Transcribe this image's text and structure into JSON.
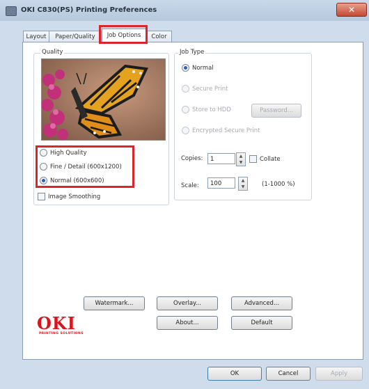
{
  "window": {
    "title": "OKI C830(PS) Printing Preferences",
    "close_glyph": "✕"
  },
  "tabs": [
    {
      "label": "Layout"
    },
    {
      "label": "Paper/Quality"
    },
    {
      "label": "Job Options",
      "active": true
    },
    {
      "label": "Color"
    }
  ],
  "quality": {
    "group_label": "Quality",
    "options": [
      {
        "label": "High Quality",
        "selected": false
      },
      {
        "label": "Fine / Detail (600x1200)",
        "selected": false
      },
      {
        "label": "Normal (600x600)",
        "selected": true
      }
    ],
    "image_smoothing_label": "Image Smoothing",
    "image_smoothing_checked": false
  },
  "job_type": {
    "group_label": "Job Type",
    "options": [
      {
        "label": "Normal",
        "selected": true,
        "enabled": true
      },
      {
        "label": "Secure Print",
        "selected": false,
        "enabled": false
      },
      {
        "label": "Store to HDD",
        "selected": false,
        "enabled": false
      },
      {
        "label": "Encrypted Secure Print",
        "selected": false,
        "enabled": false
      }
    ],
    "password_button": "Password..."
  },
  "copies": {
    "label": "Copies:",
    "value": "1",
    "collate_label": "Collate",
    "collate_checked": false
  },
  "scale": {
    "label": "Scale:",
    "value": "100",
    "range": "(1-1000 %)"
  },
  "buttons": {
    "watermark": "Watermark...",
    "overlay": "Overlay...",
    "advanced": "Advanced...",
    "about": "About...",
    "default": "Default"
  },
  "brand": {
    "logo": "OKI",
    "tagline": "PRINTING SOLUTIONS"
  },
  "footer": {
    "ok": "OK",
    "cancel": "Cancel",
    "apply": "Apply"
  },
  "colors": {
    "highlight": "#d9252b",
    "brand_red": "#d8151c",
    "radio_selected": "#2c61b7"
  },
  "icons": [
    "printer-icon",
    "close-icon",
    "spin-up-icon",
    "spin-down-icon"
  ]
}
